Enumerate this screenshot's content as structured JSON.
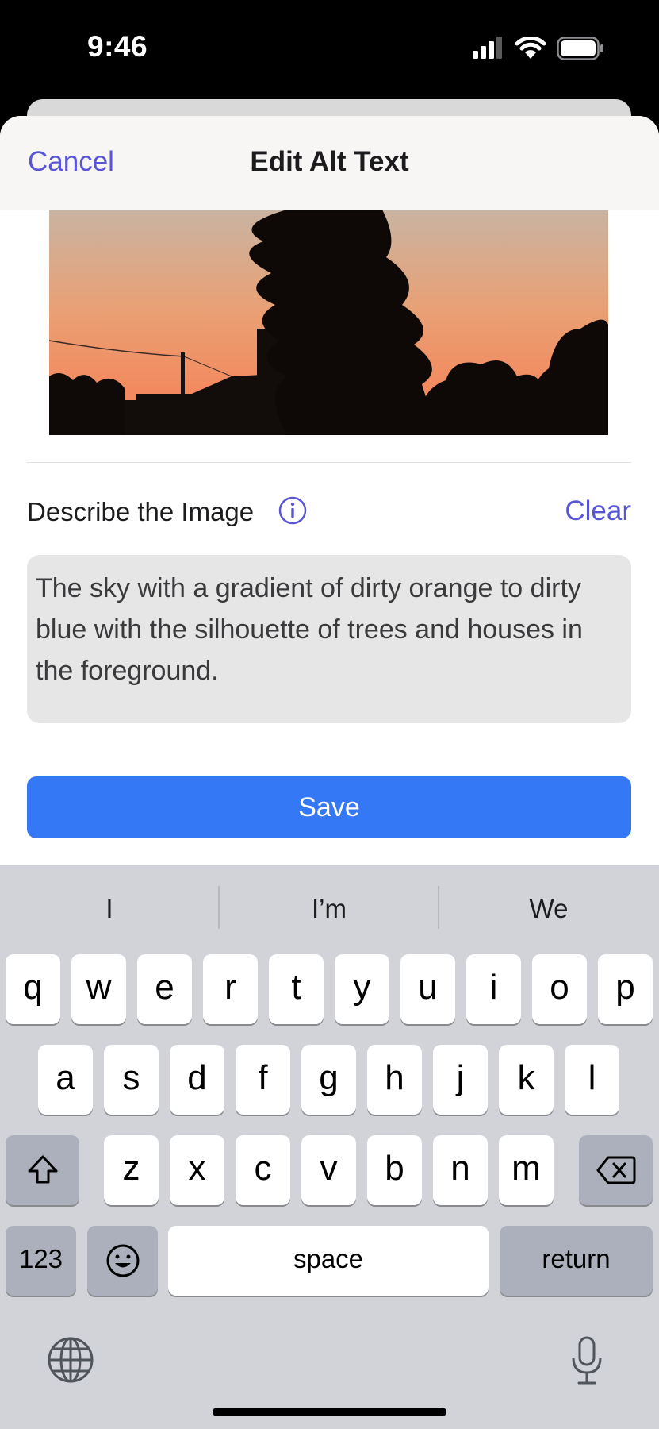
{
  "status_bar": {
    "time": "9:46"
  },
  "navbar": {
    "cancel_label": "Cancel",
    "title": "Edit Alt Text"
  },
  "describe": {
    "label": "Describe the Image",
    "clear_label": "Clear"
  },
  "alt_text": "The sky with a gradient of dirty orange to dirty blue with the silhouette of trees and houses in the foreground.",
  "save_label": "Save",
  "keyboard": {
    "suggestions": [
      "I",
      "I’m",
      "We"
    ],
    "row1": [
      "q",
      "w",
      "e",
      "r",
      "t",
      "y",
      "u",
      "i",
      "o",
      "p"
    ],
    "row2": [
      "a",
      "s",
      "d",
      "f",
      "g",
      "h",
      "j",
      "k",
      "l"
    ],
    "row3": [
      "z",
      "x",
      "c",
      "v",
      "b",
      "n",
      "m"
    ],
    "numbers_label": "123",
    "space_label": "space",
    "return_label": "return"
  },
  "colors": {
    "accent": "#5856d6",
    "save_button": "#3478f6",
    "keyboard_bg": "#d1d3d9"
  },
  "icons": [
    "cellular-signal-icon",
    "wifi-icon",
    "battery-icon",
    "info-icon",
    "shift-icon",
    "delete-icon",
    "emoji-icon",
    "globe-icon",
    "microphone-icon"
  ]
}
